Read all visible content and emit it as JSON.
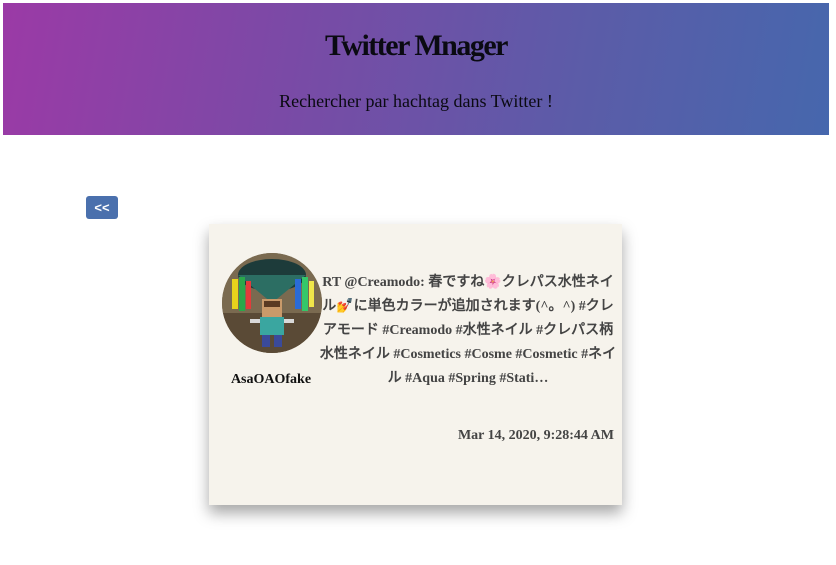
{
  "header": {
    "title": "Twitter Mnager",
    "subtitle": "Rechercher par hachtag dans Twitter !"
  },
  "navigation": {
    "back_label": "<<"
  },
  "tweet": {
    "username": "AsaOAOfake",
    "text": "RT @Creamodo: 春ですね🌸クレパス水性ネイル💅に単色カラーが追加されます(^。^) #クレアモード #Creamodo #水性ネイル #クレパス柄水性ネイル #Cosmetics #Cosme #Cosmetic #ネイル #Aqua #Spring #Stati…",
    "timestamp": "Mar 14, 2020, 9:28:44 AM"
  },
  "colors": {
    "header_gradient_start": "#9b3aa6",
    "header_gradient_end": "#4667ad",
    "button_bg": "#4a70ad",
    "card_bg": "#f6f3ec"
  }
}
